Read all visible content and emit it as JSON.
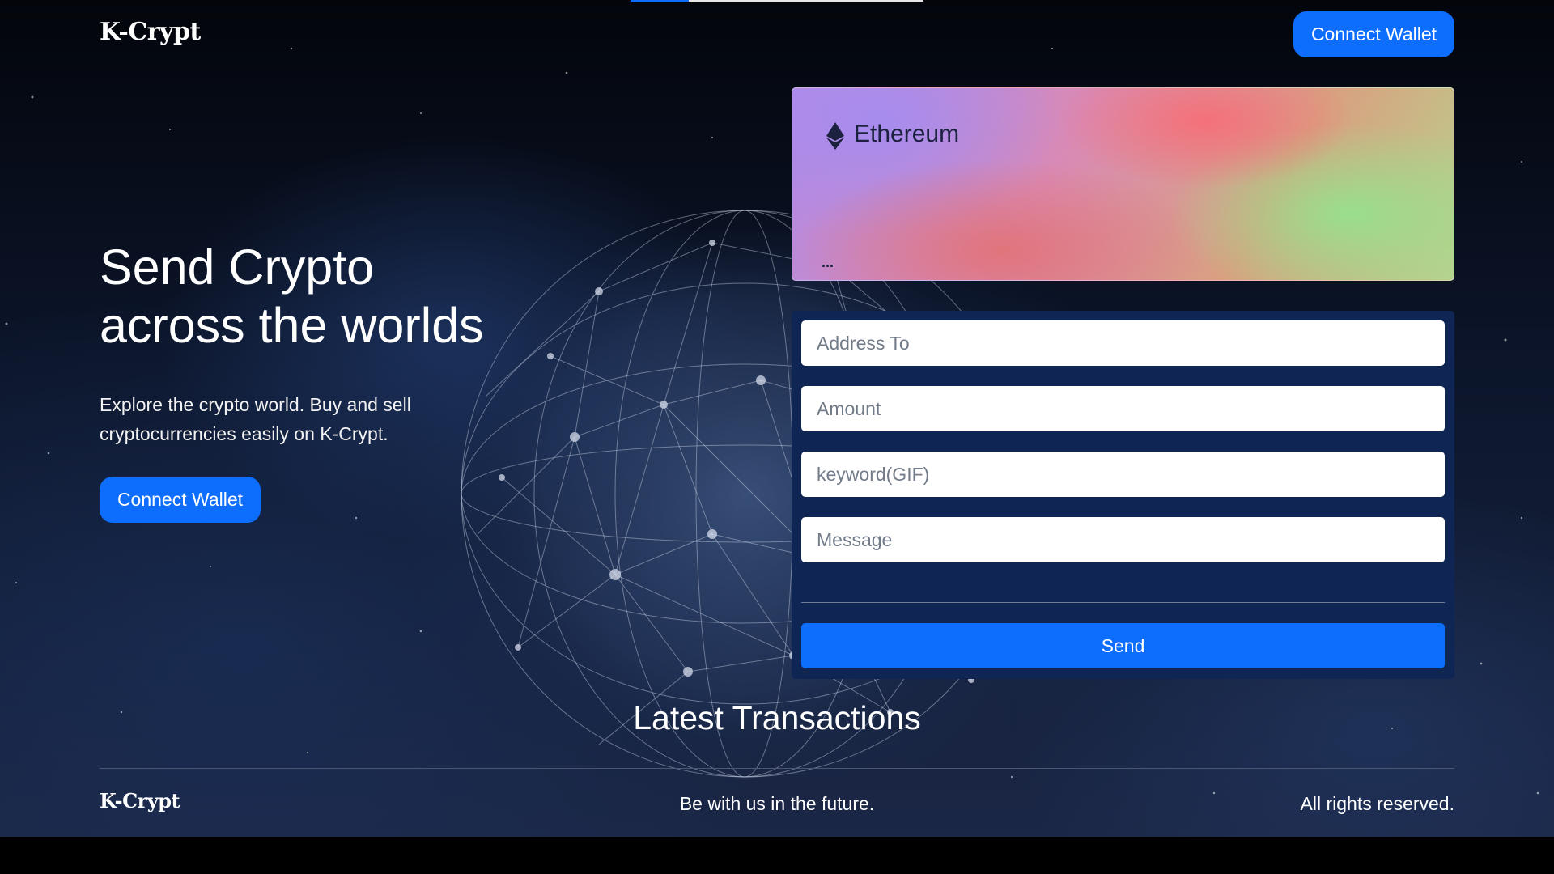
{
  "header": {
    "logo": "K-Crypt",
    "connect_wallet_label": "Connect Wallet"
  },
  "hero": {
    "title_line1": "Send Crypto",
    "title_line2": "across the worlds",
    "subtitle_line1": "Explore the crypto world. Buy and sell",
    "subtitle_line2": "cryptocurrencies easily on K-Crypt.",
    "connect_wallet_label": "Connect Wallet"
  },
  "card": {
    "icon": "ethereum-icon",
    "network": "Ethereum",
    "address": "..."
  },
  "form": {
    "address_to_placeholder": "Address To",
    "amount_placeholder": "Amount",
    "keyword_placeholder": "keyword(GIF)",
    "message_placeholder": "Message",
    "send_label": "Send"
  },
  "transactions": {
    "title": "Latest Transactions"
  },
  "footer": {
    "logo": "K-Crypt",
    "tagline": "Be with us in the future.",
    "rights": "All rights reserved."
  },
  "colors": {
    "accent": "#0d6efd",
    "form_panel": "#0f2554",
    "page_bottom": "#000000"
  },
  "loading_bar": {
    "progress_percent": 20
  }
}
